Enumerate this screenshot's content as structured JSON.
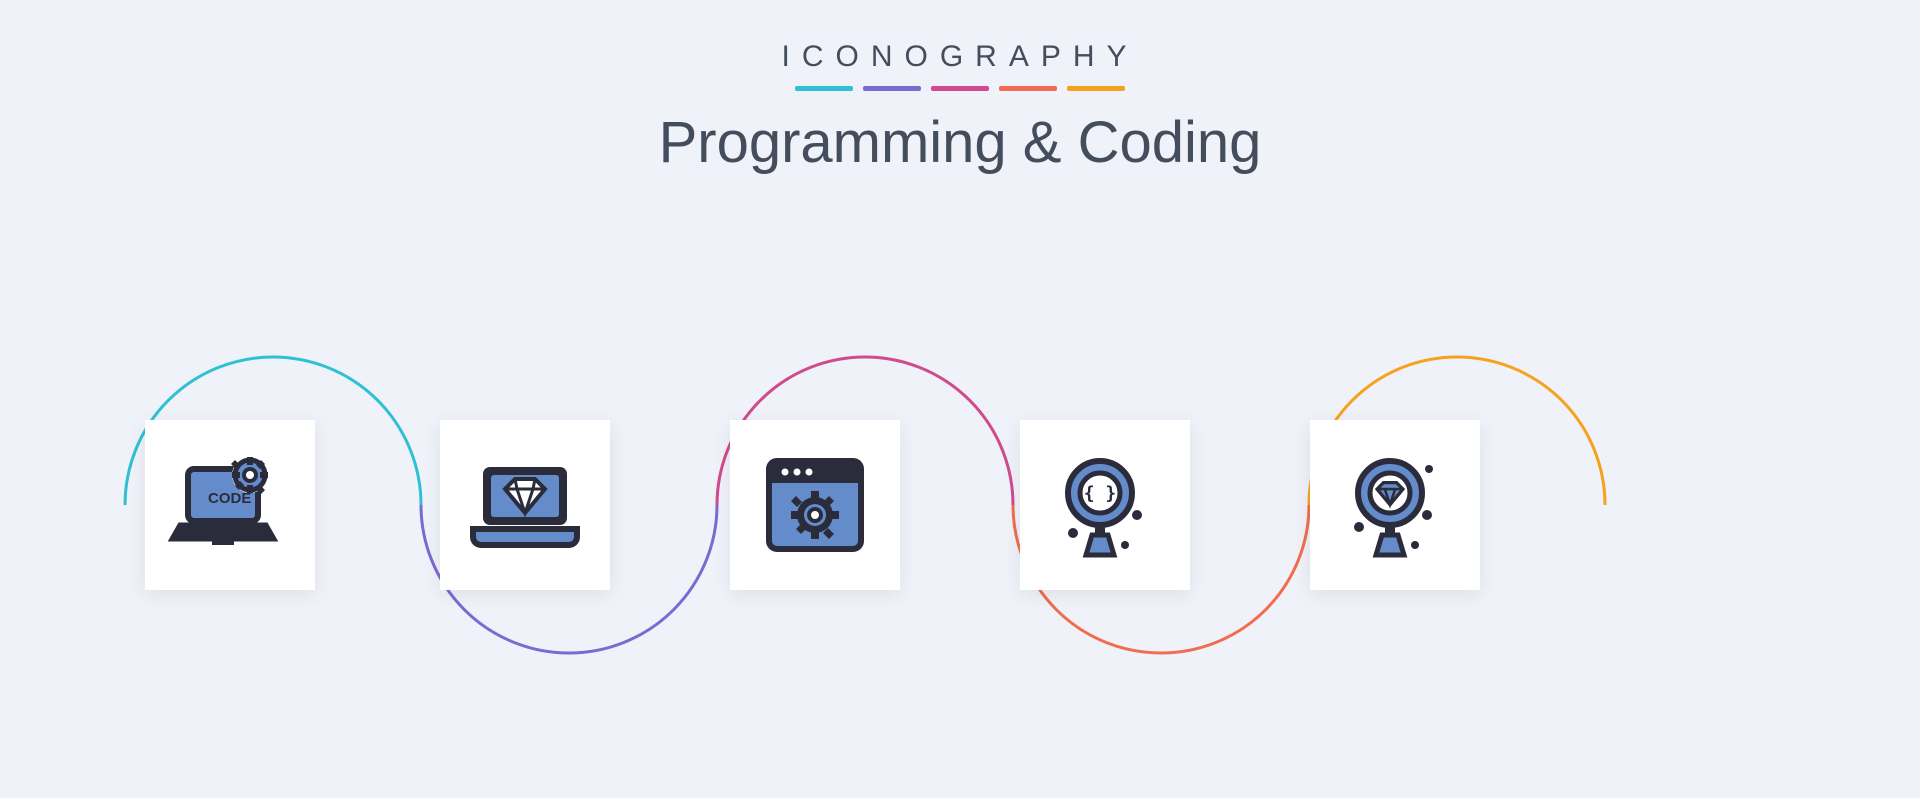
{
  "header": {
    "small_title": "ICONOGRAPHY",
    "big_title": "Programming & Coding"
  },
  "palette": {
    "cyan": "#2fc0d4",
    "purple": "#7a6bd0",
    "pink": "#d14a8f",
    "orange": "#f26c4f",
    "amber": "#f6a21e",
    "dark": "#2b2c3b",
    "accent": "#648ccb",
    "bg": "#eff2f8",
    "tile": "#ffffff"
  },
  "icons": [
    {
      "name": "laptop-code-gear-icon",
      "code_label": "CODE"
    },
    {
      "name": "laptop-diamond-icon",
      "code_label": ""
    },
    {
      "name": "browser-gear-icon",
      "code_label": ""
    },
    {
      "name": "magnifier-code-icon",
      "code_label": ""
    },
    {
      "name": "magnifier-diamond-icon",
      "code_label": ""
    }
  ]
}
